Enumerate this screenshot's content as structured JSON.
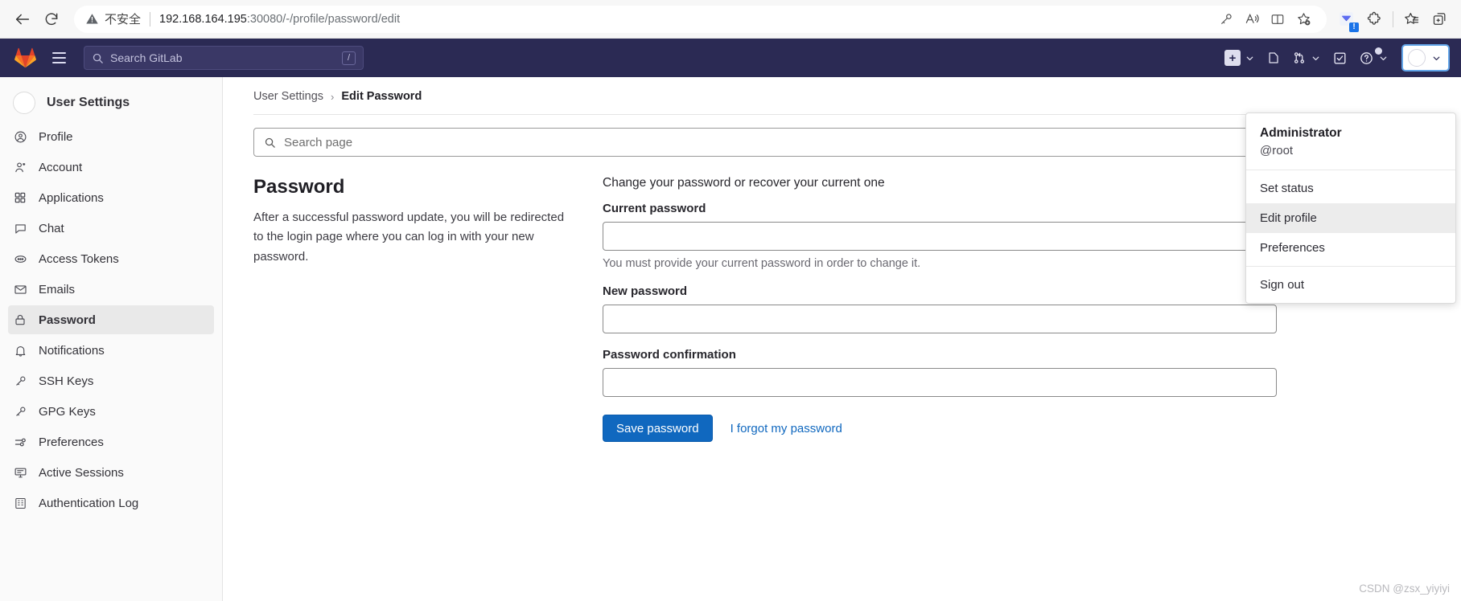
{
  "browser": {
    "back_label": "Back",
    "reload_label": "Reload",
    "security_text": "不安全",
    "url_host": "192.168.164.195",
    "url_path": ":30080/-/profile/password/edit",
    "pill_icons": [
      "key-icon",
      "read-aloud-icon",
      "split-screen-icon",
      "add-favorite-icon"
    ],
    "ext_icons": [
      "messenger-extension-icon",
      "extensions-puzzle-icon",
      "favorites-star-icon",
      "collections-icon"
    ],
    "ext_badge": "!"
  },
  "navbar": {
    "logo": "gitlab-logo",
    "menu_label": "Main menu",
    "search_placeholder": "Search GitLab",
    "search_shortcut": "/",
    "items": [
      {
        "name": "create-new-menu",
        "icon": "plus-square-icon",
        "label": "Create new"
      },
      {
        "name": "issues",
        "icon": "issues-icon",
        "label": "Issues"
      },
      {
        "name": "merge-requests",
        "icon": "merge-request-icon",
        "label": "Merge requests"
      },
      {
        "name": "todos",
        "icon": "todo-checkbox-icon",
        "label": "To-Do List"
      },
      {
        "name": "help",
        "icon": "help-circle-icon",
        "label": "Help"
      }
    ],
    "avatar_label": "User menu"
  },
  "user_dropdown": {
    "name": "Administrator",
    "handle": "@root",
    "items": [
      {
        "label": "Set status",
        "hovered": false
      },
      {
        "label": "Edit profile",
        "hovered": true
      },
      {
        "label": "Preferences",
        "hovered": false
      }
    ],
    "sign_out": "Sign out"
  },
  "sidebar": {
    "title": "User Settings",
    "avatar": "user-avatar",
    "items": [
      {
        "label": "Profile",
        "icon": "profile-icon",
        "active": false
      },
      {
        "label": "Account",
        "icon": "account-icon",
        "active": false
      },
      {
        "label": "Applications",
        "icon": "applications-icon",
        "active": false
      },
      {
        "label": "Chat",
        "icon": "chat-icon",
        "active": false
      },
      {
        "label": "Access Tokens",
        "icon": "token-icon",
        "active": false
      },
      {
        "label": "Emails",
        "icon": "email-icon",
        "active": false
      },
      {
        "label": "Password",
        "icon": "lock-icon",
        "active": true
      },
      {
        "label": "Notifications",
        "icon": "bell-icon",
        "active": false
      },
      {
        "label": "SSH Keys",
        "icon": "key-icon",
        "active": false
      },
      {
        "label": "GPG Keys",
        "icon": "key-icon",
        "active": false
      },
      {
        "label": "Preferences",
        "icon": "preferences-icon",
        "active": false
      },
      {
        "label": "Active Sessions",
        "icon": "monitor-icon",
        "active": false
      },
      {
        "label": "Authentication Log",
        "icon": "log-icon",
        "active": false
      }
    ]
  },
  "breadcrumb": {
    "parent": "User Settings",
    "separator": "›",
    "current": "Edit Password"
  },
  "search_page": {
    "placeholder": "Search page",
    "icon": "search-icon"
  },
  "main": {
    "section_title": "Password",
    "section_desc": "After a successful password update, you will be redirected to the login page where you can log in with your new password.",
    "form_legend": "Change your password or recover your current one",
    "fields": [
      {
        "label": "Current password",
        "value": "",
        "help": "You must provide your current password in order to change it."
      },
      {
        "label": "New password",
        "value": "",
        "help": ""
      },
      {
        "label": "Password confirmation",
        "value": "",
        "help": ""
      }
    ],
    "save_button": "Save password",
    "forgot_link": "I forgot my password"
  },
  "watermark": "CSDN @zsx_yiyiyi",
  "colors": {
    "navbar_bg": "#2b2a54",
    "primary_button": "#1068bf",
    "link": "#1068bf",
    "active_sidebar": "#e9e9e9",
    "gitlab_orange": "#e24329"
  }
}
